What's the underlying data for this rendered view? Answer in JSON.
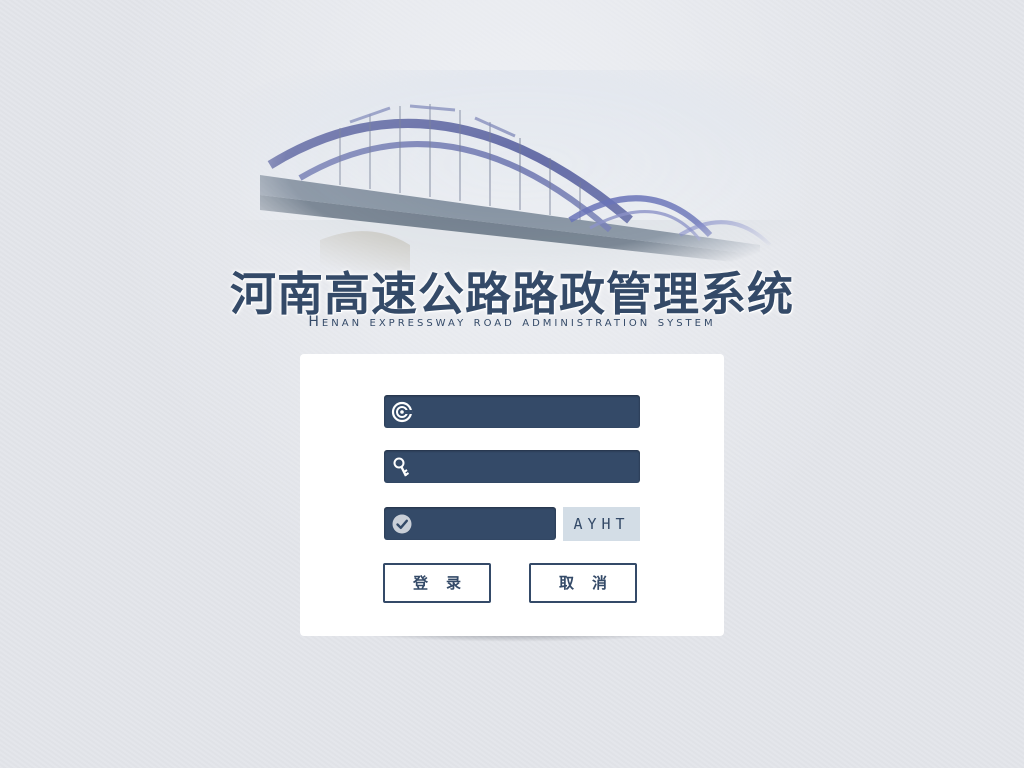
{
  "header": {
    "title_cn": "河南高速公路路政管理系统",
    "title_en": "Henan expressway road administration system"
  },
  "login": {
    "username": {
      "value": "",
      "icon": "user-icon"
    },
    "password": {
      "value": "",
      "icon": "key-icon"
    },
    "verification": {
      "value": "",
      "icon": "check-icon"
    },
    "captcha_text": "AYHT",
    "login_label": "登录",
    "cancel_label": "取消"
  },
  "colors": {
    "primary": "#344a68",
    "panel": "#ffffff",
    "captcha_bg": "#d3dde6",
    "page_bg": "#e3e5ea"
  }
}
